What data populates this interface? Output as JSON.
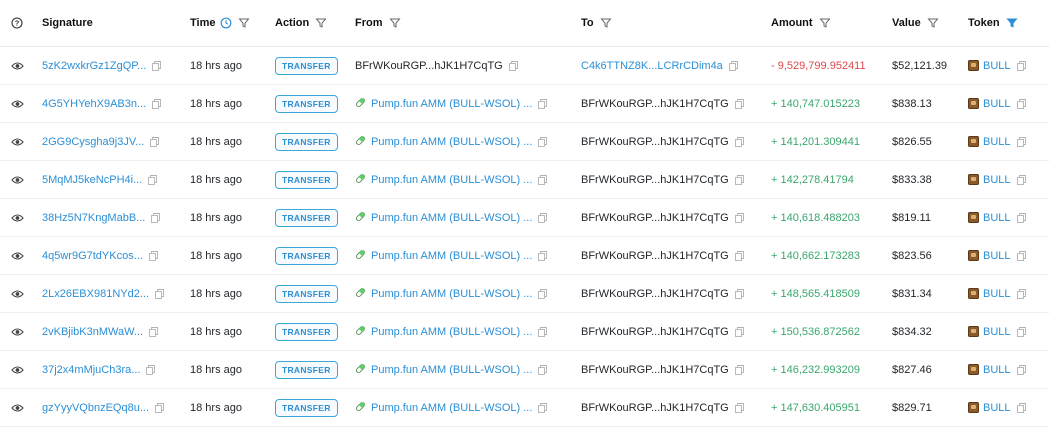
{
  "header": {
    "signature": "Signature",
    "time": "Time",
    "action": "Action",
    "from": "From",
    "to": "To",
    "amount": "Amount",
    "value": "Value",
    "token": "Token"
  },
  "colors": {
    "link": "#2b8fd6",
    "negative": "#e0484e",
    "positive": "#3aa76d",
    "badge_border": "#3ea7d9",
    "token_filter_active": "#2b8fd6"
  },
  "rows": [
    {
      "signature": "5zK2wxkrGz1ZgQP...",
      "time": "18 hrs ago",
      "action": "TRANSFER",
      "from": "BFrWKouRGP...hJK1H7CqTG",
      "from_is_pool": false,
      "to": "C4k6TTNZ8K...LCRrCDim4a",
      "to_is_link": true,
      "amount": "- 9,529,799.952411",
      "amount_sign": "neg",
      "value": "$52,121.39",
      "token": "BULL"
    },
    {
      "signature": "4G5YHYehX9AB3n...",
      "time": "18 hrs ago",
      "action": "TRANSFER",
      "from": "Pump.fun AMM (BULL-WSOL) ...",
      "from_is_pool": true,
      "to": "BFrWKouRGP...hJK1H7CqTG",
      "to_is_link": false,
      "amount": "+ 140,747.015223",
      "amount_sign": "pos",
      "value": "$838.13",
      "token": "BULL"
    },
    {
      "signature": "2GG9Cysgha9j3JV...",
      "time": "18 hrs ago",
      "action": "TRANSFER",
      "from": "Pump.fun AMM (BULL-WSOL) ...",
      "from_is_pool": true,
      "to": "BFrWKouRGP...hJK1H7CqTG",
      "to_is_link": false,
      "amount": "+ 141,201.309441",
      "amount_sign": "pos",
      "value": "$826.55",
      "token": "BULL"
    },
    {
      "signature": "5MqMJ5keNcPH4i...",
      "time": "18 hrs ago",
      "action": "TRANSFER",
      "from": "Pump.fun AMM (BULL-WSOL) ...",
      "from_is_pool": true,
      "to": "BFrWKouRGP...hJK1H7CqTG",
      "to_is_link": false,
      "amount": "+ 142,278.41794",
      "amount_sign": "pos",
      "value": "$833.38",
      "token": "BULL"
    },
    {
      "signature": "38Hz5N7KngMabB...",
      "time": "18 hrs ago",
      "action": "TRANSFER",
      "from": "Pump.fun AMM (BULL-WSOL) ...",
      "from_is_pool": true,
      "to": "BFrWKouRGP...hJK1H7CqTG",
      "to_is_link": false,
      "amount": "+ 140,618.488203",
      "amount_sign": "pos",
      "value": "$819.11",
      "token": "BULL"
    },
    {
      "signature": "4q5wr9G7tdYKcos...",
      "time": "18 hrs ago",
      "action": "TRANSFER",
      "from": "Pump.fun AMM (BULL-WSOL) ...",
      "from_is_pool": true,
      "to": "BFrWKouRGP...hJK1H7CqTG",
      "to_is_link": false,
      "amount": "+ 140,662.173283",
      "amount_sign": "pos",
      "value": "$823.56",
      "token": "BULL"
    },
    {
      "signature": "2Lx26EBX981NYd2...",
      "time": "18 hrs ago",
      "action": "TRANSFER",
      "from": "Pump.fun AMM (BULL-WSOL) ...",
      "from_is_pool": true,
      "to": "BFrWKouRGP...hJK1H7CqTG",
      "to_is_link": false,
      "amount": "+ 148,565.418509",
      "amount_sign": "pos",
      "value": "$831.34",
      "token": "BULL"
    },
    {
      "signature": "2vKBjibK3nMWaW...",
      "time": "18 hrs ago",
      "action": "TRANSFER",
      "from": "Pump.fun AMM (BULL-WSOL) ...",
      "from_is_pool": true,
      "to": "BFrWKouRGP...hJK1H7CqTG",
      "to_is_link": false,
      "amount": "+ 150,536.872562",
      "amount_sign": "pos",
      "value": "$834.32",
      "token": "BULL"
    },
    {
      "signature": "37j2x4mMjuCh3ra...",
      "time": "18 hrs ago",
      "action": "TRANSFER",
      "from": "Pump.fun AMM (BULL-WSOL) ...",
      "from_is_pool": true,
      "to": "BFrWKouRGP...hJK1H7CqTG",
      "to_is_link": false,
      "amount": "+ 146,232.993209",
      "amount_sign": "pos",
      "value": "$827.46",
      "token": "BULL"
    },
    {
      "signature": "gzYyyVQbnzEQq8u...",
      "time": "18 hrs ago",
      "action": "TRANSFER",
      "from": "Pump.fun AMM (BULL-WSOL) ...",
      "from_is_pool": true,
      "to": "BFrWKouRGP...hJK1H7CqTG",
      "to_is_link": false,
      "amount": "+ 147,630.405951",
      "amount_sign": "pos",
      "value": "$829.71",
      "token": "BULL"
    }
  ]
}
